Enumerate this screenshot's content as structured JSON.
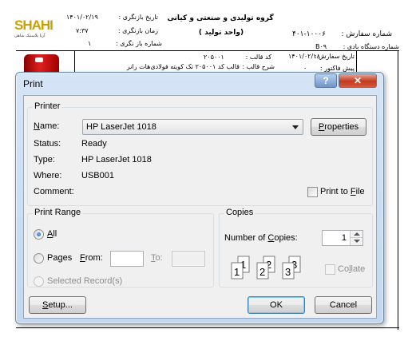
{
  "report": {
    "logo_text": "SHAHI",
    "logo_subtitle": "آرتا پلاستیک شاهی",
    "company_name": "گروه تولیدی و صنعتی و کیانی",
    "unit_label": "(واحد تولید )",
    "review_date_label": "تاریخ بازنگری :",
    "review_date_value": "۱۴۰۱/۰۲/۱۹",
    "review_time_label": "زمان بازنگری :",
    "review_time_value": "۷:۳۷",
    "review_count_label": "شماره باز نگری :",
    "review_count_value": "۱",
    "order_number_label": "شماره سفارش :",
    "order_number_value": "۴۰۱-۱۰۰۰۶",
    "device_number_label": "شماره دستگاه بادی :",
    "device_number_value": "B۰۹",
    "order_date_label": "تاریخ سفارش :",
    "order_date_value": "۱۴۰۱/۰۲/۱۸",
    "mold_code_label": "کد قالب :",
    "mold_code_value": "۲۰۵۰۰۱",
    "mold_desc_label": "شرح قالب :",
    "mold_desc_value": "قالب کد ۲۰۵۰۰۱ تک کویته فولادی‌هات رانر",
    "invoice_label": "پیش فاکتور :",
    "invoice_value": "۰"
  },
  "dialog": {
    "title": "Print",
    "help_glyph": "?",
    "close_glyph": "✕",
    "printer_group": "Printer",
    "name_label": "Name:",
    "printer_selected": "HP LaserJet 1018",
    "properties_button": "Properties",
    "status_label": "Status:",
    "status_value": "Ready",
    "type_label": "Type:",
    "type_value": "HP LaserJet 1018",
    "where_label": "Where:",
    "where_value": "USB001",
    "comment_label": "Comment:",
    "comment_value": "",
    "print_to_file": "Print to File",
    "print_range_group": "Print Range",
    "all_label": "All",
    "pages_label": "Pages",
    "from_label": "From:",
    "from_value": "",
    "to_label": "To:",
    "to_value": "",
    "selected_records_label": "Selected Record(s)",
    "copies_group": "Copies",
    "num_copies_label": "Number of Copies:",
    "num_copies_value": "1",
    "collate_label": "Collate",
    "setup_button": "Setup...",
    "ok_button": "OK",
    "cancel_button": "Cancel"
  },
  "colors": {
    "dialog_frame": "#c3d8ef",
    "close_button": "#c23a1f",
    "client_bg": "#f0f0f0"
  }
}
